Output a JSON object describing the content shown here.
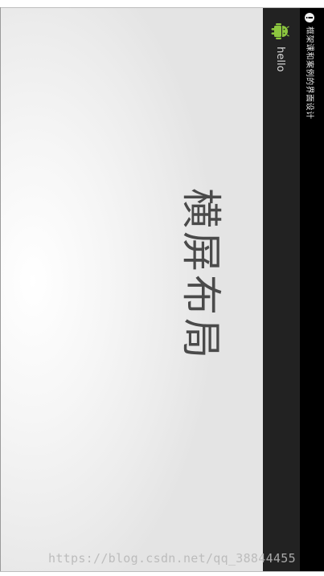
{
  "status_bar": {
    "notification_text": "框架课和案例的界面设计",
    "notification_icon": "info-icon"
  },
  "title_bar": {
    "app_title": "hello",
    "app_icon": "android-icon"
  },
  "content": {
    "main_text": "横屏布局"
  },
  "watermark": {
    "text": "https://blog.csdn.net/qq_38844455"
  },
  "colors": {
    "status_bar_bg": "#000000",
    "title_bar_bg": "#222222",
    "main_text": "#4a4a4a",
    "android_green": "#8cc63f"
  }
}
